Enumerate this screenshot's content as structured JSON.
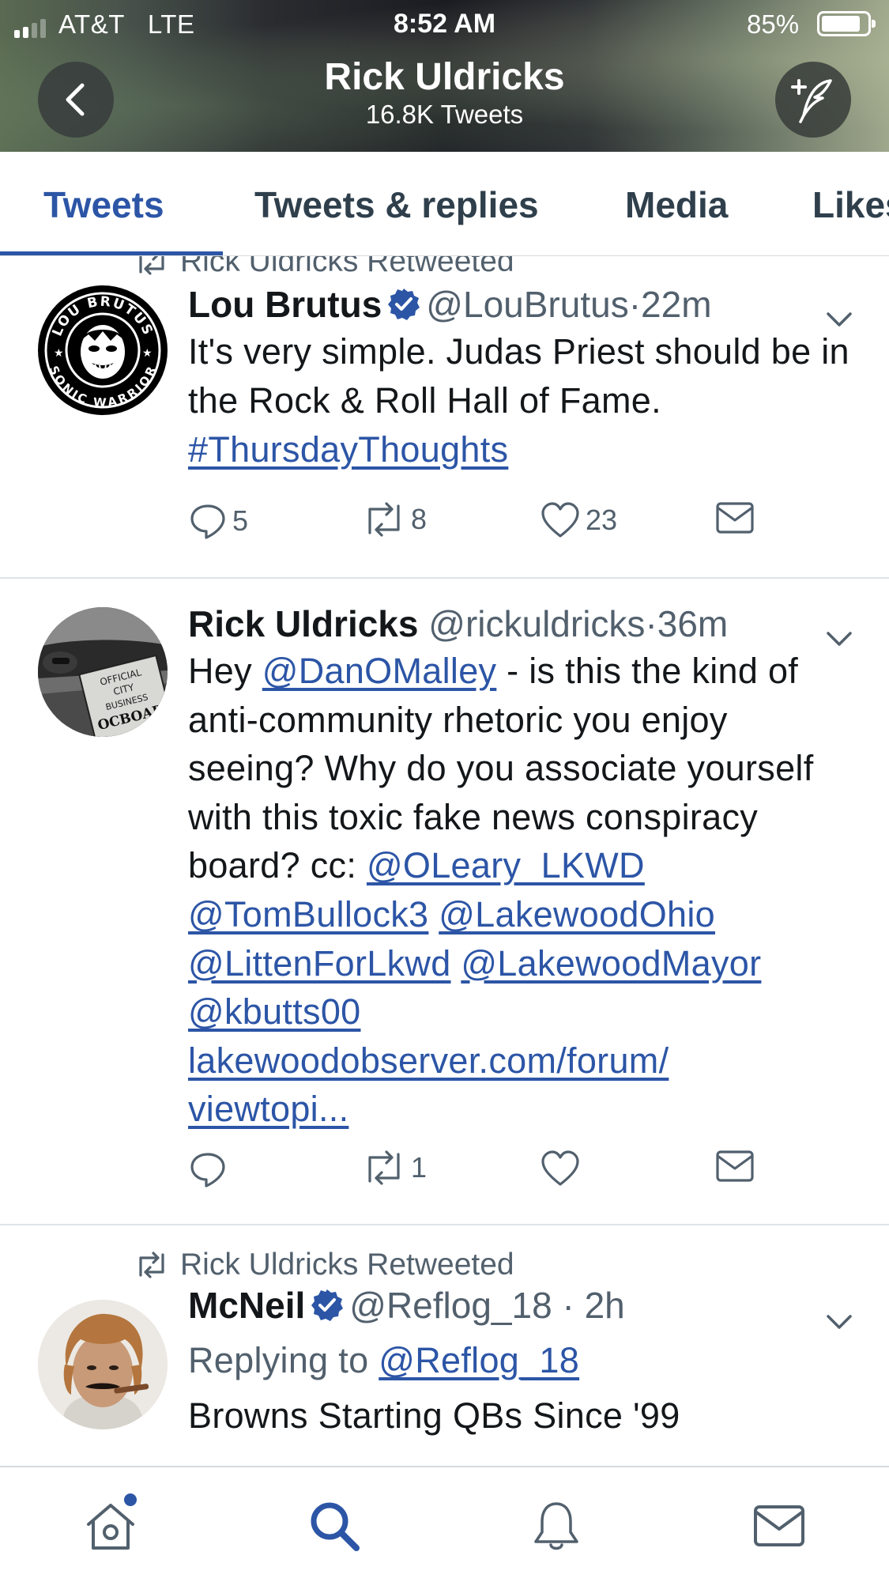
{
  "status_bar": {
    "carrier": "AT&T",
    "network": "LTE",
    "time": "8:52 AM",
    "battery_percent": "85%",
    "battery_level": 0.85,
    "signal_bars": 4,
    "signal_bars_active": 2
  },
  "header": {
    "name": "Rick Uldricks",
    "tweet_count": "16.8K Tweets",
    "back_icon": "chevron-left-icon",
    "compose_icon": "compose-quill-icon"
  },
  "tabs": [
    {
      "label": "Tweets",
      "active": true
    },
    {
      "label": "Tweets & replies",
      "active": false
    },
    {
      "label": "Media",
      "active": false
    },
    {
      "label": "Likes",
      "active": false
    }
  ],
  "colors": {
    "accent": "#2c55a6",
    "text": "#14171a",
    "muted": "#52606d",
    "divider": "#dfe3e7"
  },
  "tweets": [
    {
      "retweeted_by": "Rick Uldricks Retweeted",
      "name": "Lou Brutus",
      "verified": true,
      "handle": "@LouBrutus",
      "dot": "·",
      "time": "22m",
      "avatar_text_top": "LOU BRUTUS",
      "avatar_text_bottom": "SONIC WARRIOR",
      "body_text": "It's very simple. Judas Priest should be in the Rock & Roll Hall of Fame.",
      "hashtag": "#ThursdayThoughts",
      "replies": "5",
      "retweets": "8",
      "likes": "23"
    },
    {
      "name": "Rick Uldricks",
      "verified": false,
      "handle": "@rickuldricks",
      "dot": "·",
      "time": "36m",
      "avatar_sign": [
        "OFFICIAL",
        "CITY",
        "BUSINESS",
        "OCBOAR"
      ],
      "body_prefix": "Hey",
      "mention_dan": "@DanOMalley",
      "body_mid": "- is this the kind of anti-community rhetoric you enjoy seeing? Why do you associate yourself with this toxic fake news conspiracy board? cc:",
      "mentions": [
        "@OLeary_LKWD",
        "@TomBullock3",
        "@LakewoodOhio",
        "@LittenForLkwd",
        "@LakewoodMayor",
        "@kbutts00"
      ],
      "url_line1": "lakewoodobserver.com/forum/",
      "url_line2": "viewtopi...",
      "replies": "",
      "retweets": "1",
      "likes": ""
    },
    {
      "retweeted_by": "Rick Uldricks Retweeted",
      "name": "McNeil",
      "verified": true,
      "handle": "@Reflog_18",
      "dot": "·",
      "time": "2h",
      "replying_label": "Replying to",
      "replying_to": "@Reflog_18",
      "body_text": "Browns Starting QBs Since '99"
    }
  ],
  "bottom_nav": [
    {
      "icon": "home-icon",
      "active": false,
      "has_badge": true
    },
    {
      "icon": "search-icon",
      "active": true
    },
    {
      "icon": "bell-icon",
      "active": false
    },
    {
      "icon": "mail-icon",
      "active": false
    }
  ]
}
